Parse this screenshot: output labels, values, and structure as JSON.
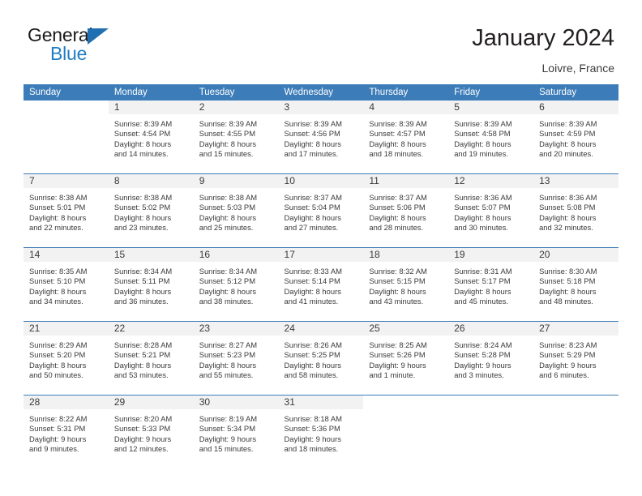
{
  "brand": {
    "word1": "General",
    "word2": "Blue",
    "flag_icon": "triangle-flag-icon",
    "accent_color": "#1f7dc4"
  },
  "header": {
    "title": "January 2024",
    "subtitle": "Loivre, France"
  },
  "theme": {
    "header_row_bg": "#3c7cb8",
    "daynum_band_bg": "#f2f2f2",
    "text_color": "#3a3a3a",
    "grid_line": "#3c7cb8"
  },
  "weekdays": [
    "Sunday",
    "Monday",
    "Tuesday",
    "Wednesday",
    "Thursday",
    "Friday",
    "Saturday"
  ],
  "weeks": [
    [
      {
        "day": "",
        "lines": [],
        "blank": true
      },
      {
        "day": "1",
        "lines": [
          "Sunrise: 8:39 AM",
          "Sunset: 4:54 PM",
          "Daylight: 8 hours",
          "and 14 minutes."
        ]
      },
      {
        "day": "2",
        "lines": [
          "Sunrise: 8:39 AM",
          "Sunset: 4:55 PM",
          "Daylight: 8 hours",
          "and 15 minutes."
        ]
      },
      {
        "day": "3",
        "lines": [
          "Sunrise: 8:39 AM",
          "Sunset: 4:56 PM",
          "Daylight: 8 hours",
          "and 17 minutes."
        ]
      },
      {
        "day": "4",
        "lines": [
          "Sunrise: 8:39 AM",
          "Sunset: 4:57 PM",
          "Daylight: 8 hours",
          "and 18 minutes."
        ]
      },
      {
        "day": "5",
        "lines": [
          "Sunrise: 8:39 AM",
          "Sunset: 4:58 PM",
          "Daylight: 8 hours",
          "and 19 minutes."
        ]
      },
      {
        "day": "6",
        "lines": [
          "Sunrise: 8:39 AM",
          "Sunset: 4:59 PM",
          "Daylight: 8 hours",
          "and 20 minutes."
        ]
      }
    ],
    [
      {
        "day": "7",
        "lines": [
          "Sunrise: 8:38 AM",
          "Sunset: 5:01 PM",
          "Daylight: 8 hours",
          "and 22 minutes."
        ]
      },
      {
        "day": "8",
        "lines": [
          "Sunrise: 8:38 AM",
          "Sunset: 5:02 PM",
          "Daylight: 8 hours",
          "and 23 minutes."
        ]
      },
      {
        "day": "9",
        "lines": [
          "Sunrise: 8:38 AM",
          "Sunset: 5:03 PM",
          "Daylight: 8 hours",
          "and 25 minutes."
        ]
      },
      {
        "day": "10",
        "lines": [
          "Sunrise: 8:37 AM",
          "Sunset: 5:04 PM",
          "Daylight: 8 hours",
          "and 27 minutes."
        ]
      },
      {
        "day": "11",
        "lines": [
          "Sunrise: 8:37 AM",
          "Sunset: 5:06 PM",
          "Daylight: 8 hours",
          "and 28 minutes."
        ]
      },
      {
        "day": "12",
        "lines": [
          "Sunrise: 8:36 AM",
          "Sunset: 5:07 PM",
          "Daylight: 8 hours",
          "and 30 minutes."
        ]
      },
      {
        "day": "13",
        "lines": [
          "Sunrise: 8:36 AM",
          "Sunset: 5:08 PM",
          "Daylight: 8 hours",
          "and 32 minutes."
        ]
      }
    ],
    [
      {
        "day": "14",
        "lines": [
          "Sunrise: 8:35 AM",
          "Sunset: 5:10 PM",
          "Daylight: 8 hours",
          "and 34 minutes."
        ]
      },
      {
        "day": "15",
        "lines": [
          "Sunrise: 8:34 AM",
          "Sunset: 5:11 PM",
          "Daylight: 8 hours",
          "and 36 minutes."
        ]
      },
      {
        "day": "16",
        "lines": [
          "Sunrise: 8:34 AM",
          "Sunset: 5:12 PM",
          "Daylight: 8 hours",
          "and 38 minutes."
        ]
      },
      {
        "day": "17",
        "lines": [
          "Sunrise: 8:33 AM",
          "Sunset: 5:14 PM",
          "Daylight: 8 hours",
          "and 41 minutes."
        ]
      },
      {
        "day": "18",
        "lines": [
          "Sunrise: 8:32 AM",
          "Sunset: 5:15 PM",
          "Daylight: 8 hours",
          "and 43 minutes."
        ]
      },
      {
        "day": "19",
        "lines": [
          "Sunrise: 8:31 AM",
          "Sunset: 5:17 PM",
          "Daylight: 8 hours",
          "and 45 minutes."
        ]
      },
      {
        "day": "20",
        "lines": [
          "Sunrise: 8:30 AM",
          "Sunset: 5:18 PM",
          "Daylight: 8 hours",
          "and 48 minutes."
        ]
      }
    ],
    [
      {
        "day": "21",
        "lines": [
          "Sunrise: 8:29 AM",
          "Sunset: 5:20 PM",
          "Daylight: 8 hours",
          "and 50 minutes."
        ]
      },
      {
        "day": "22",
        "lines": [
          "Sunrise: 8:28 AM",
          "Sunset: 5:21 PM",
          "Daylight: 8 hours",
          "and 53 minutes."
        ]
      },
      {
        "day": "23",
        "lines": [
          "Sunrise: 8:27 AM",
          "Sunset: 5:23 PM",
          "Daylight: 8 hours",
          "and 55 minutes."
        ]
      },
      {
        "day": "24",
        "lines": [
          "Sunrise: 8:26 AM",
          "Sunset: 5:25 PM",
          "Daylight: 8 hours",
          "and 58 minutes."
        ]
      },
      {
        "day": "25",
        "lines": [
          "Sunrise: 8:25 AM",
          "Sunset: 5:26 PM",
          "Daylight: 9 hours",
          "and 1 minute."
        ]
      },
      {
        "day": "26",
        "lines": [
          "Sunrise: 8:24 AM",
          "Sunset: 5:28 PM",
          "Daylight: 9 hours",
          "and 3 minutes."
        ]
      },
      {
        "day": "27",
        "lines": [
          "Sunrise: 8:23 AM",
          "Sunset: 5:29 PM",
          "Daylight: 9 hours",
          "and 6 minutes."
        ]
      }
    ],
    [
      {
        "day": "28",
        "lines": [
          "Sunrise: 8:22 AM",
          "Sunset: 5:31 PM",
          "Daylight: 9 hours",
          "and 9 minutes."
        ]
      },
      {
        "day": "29",
        "lines": [
          "Sunrise: 8:20 AM",
          "Sunset: 5:33 PM",
          "Daylight: 9 hours",
          "and 12 minutes."
        ]
      },
      {
        "day": "30",
        "lines": [
          "Sunrise: 8:19 AM",
          "Sunset: 5:34 PM",
          "Daylight: 9 hours",
          "and 15 minutes."
        ]
      },
      {
        "day": "31",
        "lines": [
          "Sunrise: 8:18 AM",
          "Sunset: 5:36 PM",
          "Daylight: 9 hours",
          "and 18 minutes."
        ]
      },
      {
        "day": "",
        "lines": [],
        "blank": true
      },
      {
        "day": "",
        "lines": [],
        "blank": true
      },
      {
        "day": "",
        "lines": [],
        "blank": true
      }
    ]
  ]
}
